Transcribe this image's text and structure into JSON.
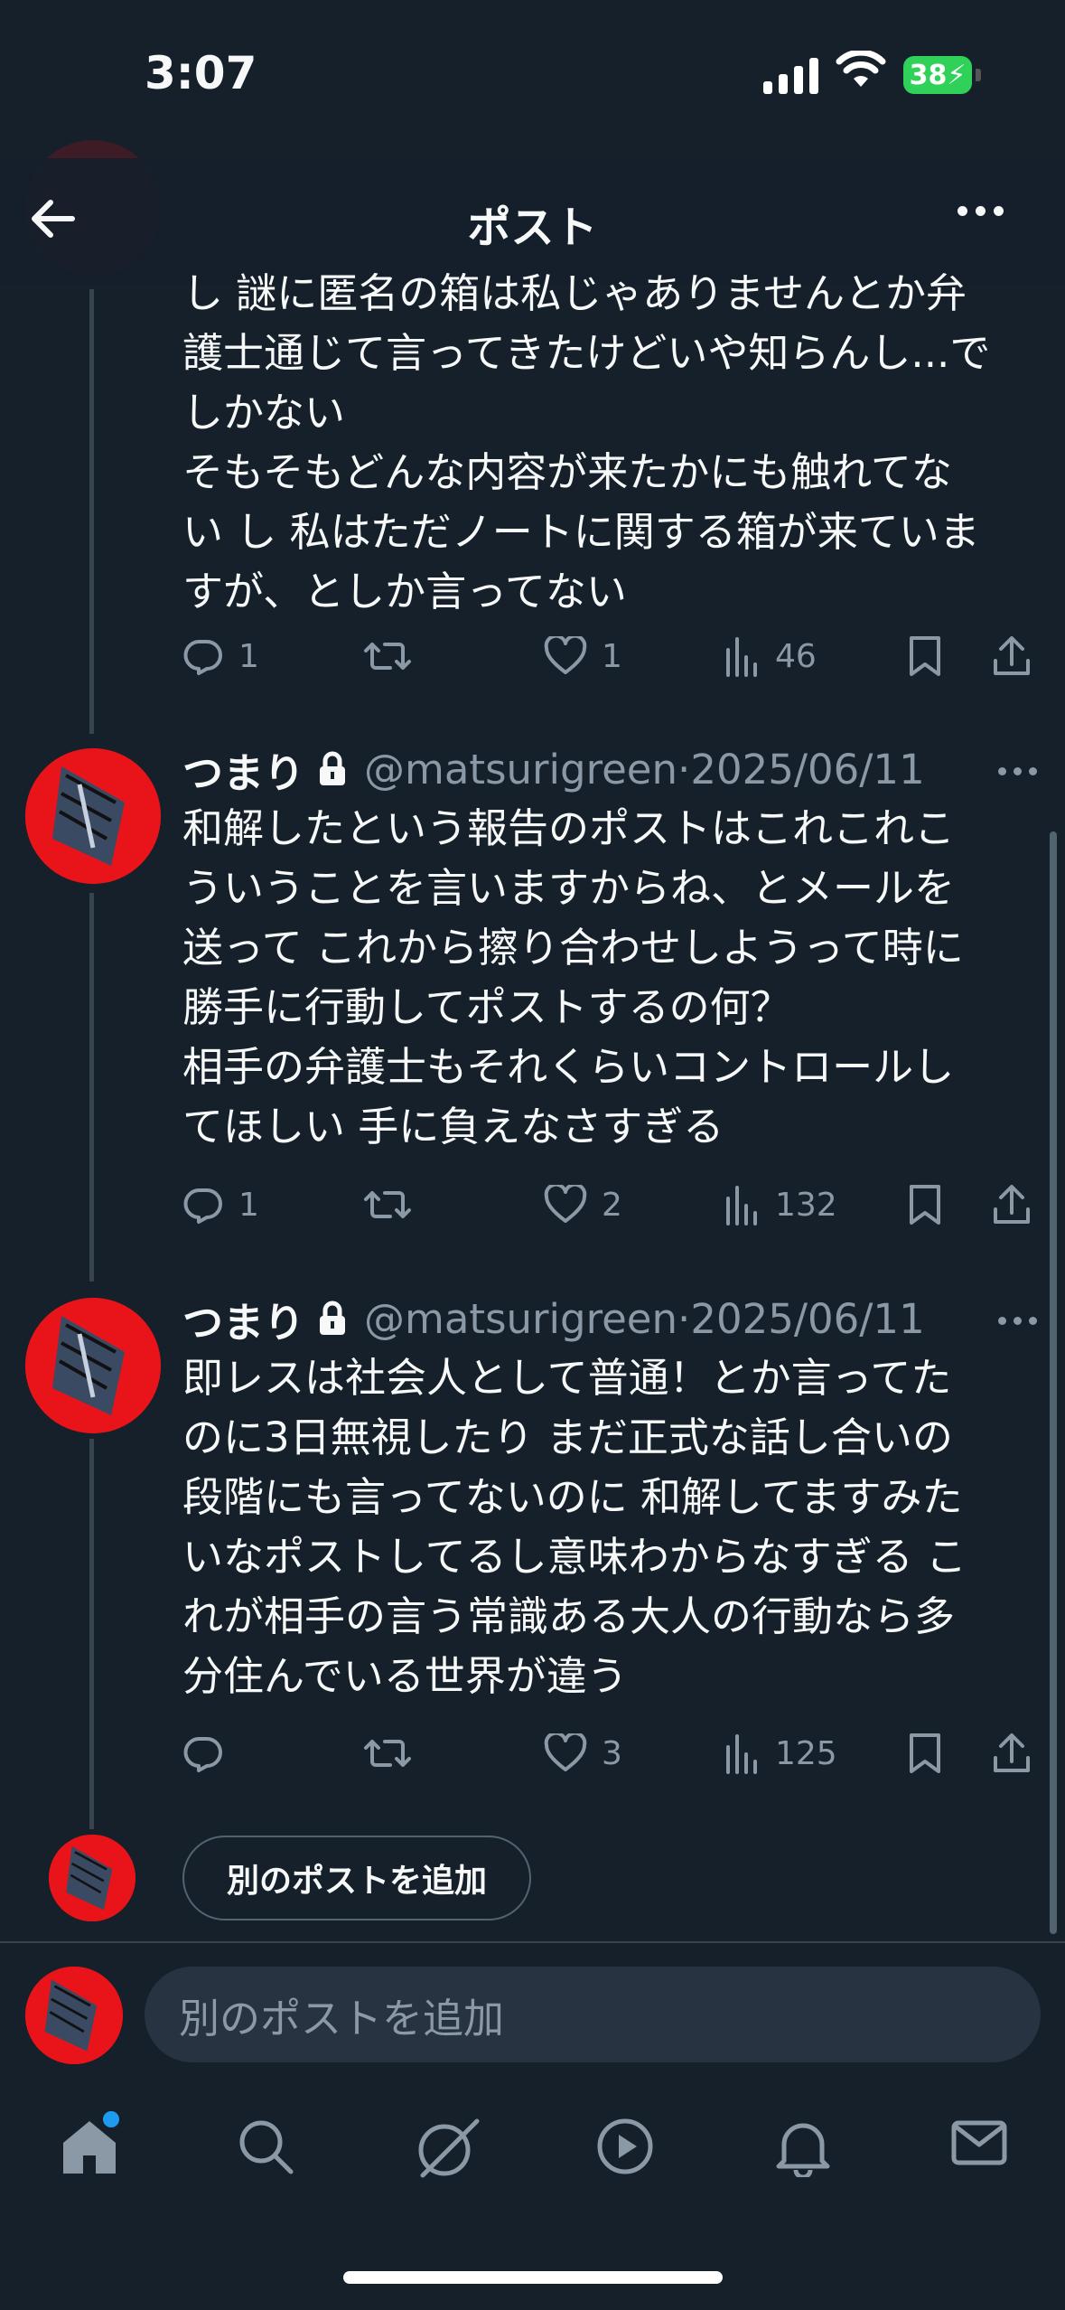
{
  "status_bar": {
    "time": "3:07",
    "battery": "38"
  },
  "header": {
    "title": "ポスト"
  },
  "thread": [
    {
      "text_lines": [
        "し 謎に匿名の箱は私じゃありませんとか弁",
        "護士通じて言ってきたけどいや知らんし...で",
        "しかない",
        "そもそもどんな内容が来たかにも触れてな",
        "い し 私はただノートに関する箱が来ていま",
        "すが、としか言ってない"
      ],
      "replies": "1",
      "reposts": "",
      "likes": "1",
      "views": "46"
    },
    {
      "name": "つまり",
      "handle": "@matsurigreen",
      "date": "2025/06/11",
      "text_lines": [
        "和解したという報告のポストはこれこれこ",
        "ういうことを言いますからね、とメールを",
        "送って これから擦り合わせしようって時に",
        "勝手に行動してポストするの何？",
        "相手の弁護士もそれくらいコントロールし",
        "てほしい 手に負えなさすぎる"
      ],
      "replies": "1",
      "reposts": "",
      "likes": "2",
      "views": "132"
    },
    {
      "name": "つまり",
      "handle": "@matsurigreen",
      "date": "2025/06/11",
      "text_lines": [
        "即レスは社会人として普通！とか言ってた",
        "のに3日無視したり まだ正式な話し合いの",
        "段階にも言ってないのに 和解してますみた",
        "いなポストしてるし意味わからなすぎる こ",
        "れが相手の言う常識ある大人の行動なら多",
        "分住んでいる世界が違う"
      ],
      "replies": "",
      "reposts": "",
      "likes": "3",
      "views": "125"
    }
  ],
  "add_post_button": "別のポストを追加",
  "compose": {
    "placeholder": "別のポストを追加"
  },
  "tabs": [
    "home-icon",
    "search-icon",
    "grok-icon",
    "video-icon",
    "notifications-icon",
    "messages-icon"
  ],
  "colors": {
    "background": "#15202b",
    "muted": "#8b98a5",
    "accent": "#1d9bf0",
    "battery": "#30d158"
  }
}
